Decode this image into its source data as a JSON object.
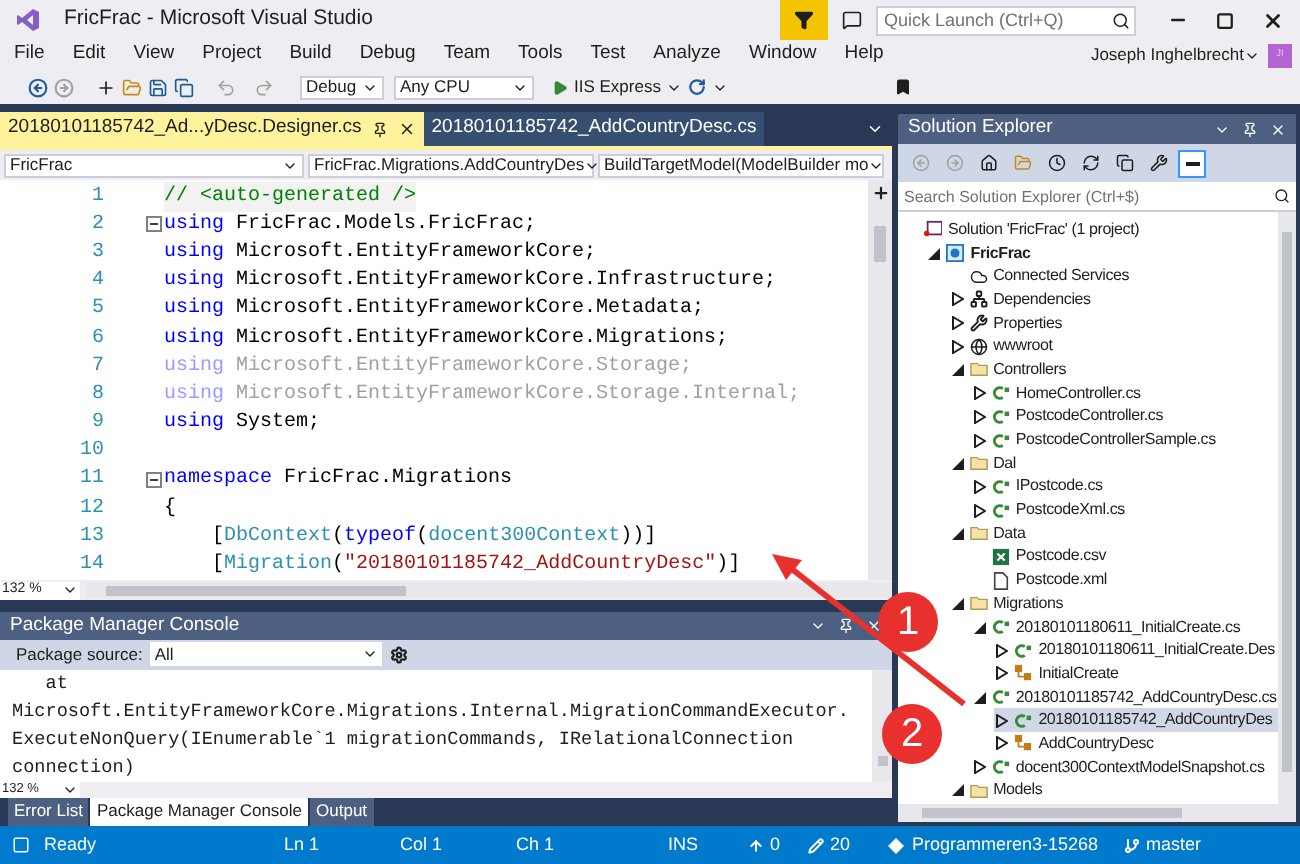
{
  "window": {
    "title": "FricFrac - Microsoft Visual Studio",
    "quick_launch": {
      "placeholder": "Quick Launch (Ctrl+Q)"
    }
  },
  "menu": [
    "File",
    "Edit",
    "View",
    "Project",
    "Build",
    "Debug",
    "Team",
    "Tools",
    "Test",
    "Analyze",
    "Window",
    "Help"
  ],
  "user": {
    "name": "Joseph Inghelbrecht",
    "initials": "JI"
  },
  "toolbar": {
    "configuration": "Debug",
    "platform": "Any CPU",
    "run": "IIS Express"
  },
  "editor": {
    "tabs": [
      {
        "label": "20180101185742_Ad...yDesc.Designer.cs",
        "selected": true
      },
      {
        "label": "20180101185742_AddCountryDesc.cs",
        "selected": false
      }
    ],
    "nav": [
      "FricFrac",
      "FricFrac.Migrations.AddCountryDes",
      "BuildTargetModel(ModelBuilder mo"
    ],
    "lines": [
      {
        "number": "1",
        "fold": false,
        "dim": false,
        "tokens": [
          {
            "kind": "comment",
            "text": "// <auto-generated />"
          }
        ]
      },
      {
        "number": "2",
        "fold": true,
        "dim": false,
        "tokens": [
          {
            "kind": "keyword",
            "text": "using"
          },
          {
            "kind": "plain",
            "text": " FricFrac.Models.FricFrac;"
          }
        ]
      },
      {
        "number": "3",
        "fold": false,
        "dim": false,
        "tokens": [
          {
            "kind": "keyword",
            "text": "using"
          },
          {
            "kind": "plain",
            "text": " Microsoft.EntityFrameworkCore;"
          }
        ]
      },
      {
        "number": "4",
        "fold": false,
        "dim": false,
        "tokens": [
          {
            "kind": "keyword",
            "text": "using"
          },
          {
            "kind": "plain",
            "text": " Microsoft.EntityFrameworkCore.Infrastructure;"
          }
        ]
      },
      {
        "number": "5",
        "fold": false,
        "dim": false,
        "tokens": [
          {
            "kind": "keyword",
            "text": "using"
          },
          {
            "kind": "plain",
            "text": " Microsoft.EntityFrameworkCore.Metadata;"
          }
        ]
      },
      {
        "number": "6",
        "fold": false,
        "dim": false,
        "tokens": [
          {
            "kind": "keyword",
            "text": "using"
          },
          {
            "kind": "plain",
            "text": " Microsoft.EntityFrameworkCore.Migrations;"
          }
        ]
      },
      {
        "number": "7",
        "fold": false,
        "dim": true,
        "tokens": [
          {
            "kind": "keyword",
            "text": "using"
          },
          {
            "kind": "plain",
            "text": " Microsoft.EntityFrameworkCore.Storage;"
          }
        ]
      },
      {
        "number": "8",
        "fold": false,
        "dim": true,
        "tokens": [
          {
            "kind": "keyword",
            "text": "using"
          },
          {
            "kind": "plain",
            "text": " Microsoft.EntityFrameworkCore.Storage.Internal;"
          }
        ]
      },
      {
        "number": "9",
        "fold": false,
        "dim": false,
        "tokens": [
          {
            "kind": "keyword",
            "text": "using"
          },
          {
            "kind": "plain",
            "text": " System;"
          }
        ]
      },
      {
        "number": "10"
      },
      {
        "number": "11",
        "fold": true,
        "dim": false,
        "tokens": [
          {
            "kind": "keyword",
            "text": "namespace"
          },
          {
            "kind": "plain",
            "text": " FricFrac.Migrations"
          }
        ]
      },
      {
        "number": "12",
        "fold": false,
        "dim": false,
        "tokens": [
          {
            "kind": "plain",
            "text": "{"
          }
        ]
      },
      {
        "number": "13",
        "fold": false,
        "dim": false,
        "tokens": [
          {
            "kind": "plain",
            "text": "    ["
          },
          {
            "kind": "type",
            "text": "DbContext"
          },
          {
            "kind": "plain",
            "text": "("
          },
          {
            "kind": "keyword",
            "text": "typeof"
          },
          {
            "kind": "plain",
            "text": "("
          },
          {
            "kind": "type",
            "text": "docent300Context"
          },
          {
            "kind": "plain",
            "text": "))]"
          }
        ]
      },
      {
        "number": "14",
        "fold": false,
        "dim": false,
        "tokens": [
          {
            "kind": "plain",
            "text": "    ["
          },
          {
            "kind": "type",
            "text": "Migration"
          },
          {
            "kind": "plain",
            "text": "("
          },
          {
            "kind": "string",
            "text": "\"20180101185742_AddCountryDesc\""
          },
          {
            "kind": "plain",
            "text": ")]"
          }
        ]
      }
    ],
    "zoom": "132 %"
  },
  "console": {
    "title": "Package Manager Console",
    "source_label": "Package source:",
    "source": "All",
    "lines": [
      "   at",
      "Microsoft.EntityFrameworkCore.Migrations.Internal.MigrationCommandExecutor.",
      "ExecuteNonQuery(IEnumerable`1 migrationCommands, IRelationalConnection",
      "connection)"
    ],
    "zoom": "132 %"
  },
  "bottom_tabs": [
    {
      "label": "Error List",
      "selected": false
    },
    {
      "label": "Package Manager Console",
      "selected": true
    },
    {
      "label": "Output",
      "selected": false
    }
  ],
  "solution_explorer": {
    "title": "Solution Explorer",
    "search": {
      "placeholder": "Search Solution Explorer (Ctrl+$)"
    },
    "tree": [
      {
        "label": "Solution 'FricFrac' (1 project)",
        "kind": "solution",
        "has_expander": false,
        "selected": false,
        "bold": false,
        "children": [
          {
            "label": "FricFrac",
            "kind": "project",
            "has_expander": true,
            "expanded": true,
            "selected": false,
            "bold": true,
            "children": [
              {
                "label": "Connected Services",
                "kind": "cloud",
                "has_expander": false,
                "selected": false,
                "bold": false
              },
              {
                "label": "Dependencies",
                "kind": "dependencies",
                "has_expander": true,
                "expanded": false,
                "selected": false,
                "bold": false
              },
              {
                "label": "Properties",
                "kind": "wrench",
                "has_expander": true,
                "expanded": false,
                "selected": false,
                "bold": false
              },
              {
                "label": "wwwroot",
                "kind": "globe",
                "has_expander": true,
                "expanded": false,
                "selected": false,
                "bold": false
              },
              {
                "label": "Controllers",
                "kind": "folder",
                "has_expander": true,
                "expanded": true,
                "selected": false,
                "bold": false,
                "children": [
                  {
                    "label": "HomeController.cs",
                    "kind": "csharp",
                    "has_expander": true,
                    "expanded": false,
                    "selected": false,
                    "bold": false
                  },
                  {
                    "label": "PostcodeController.cs",
                    "kind": "csharp",
                    "has_expander": true,
                    "expanded": false,
                    "selected": false,
                    "bold": false
                  },
                  {
                    "label": "PostcodeControllerSample.cs",
                    "kind": "csharp",
                    "has_expander": true,
                    "expanded": false,
                    "selected": false,
                    "bold": false
                  }
                ]
              },
              {
                "label": "Dal",
                "kind": "folder",
                "has_expander": true,
                "expanded": true,
                "selected": false,
                "bold": false,
                "children": [
                  {
                    "label": "IPostcode.cs",
                    "kind": "csharp",
                    "has_expander": true,
                    "expanded": false,
                    "selected": false,
                    "bold": false
                  },
                  {
                    "label": "PostcodeXml.cs",
                    "kind": "csharp",
                    "has_expander": true,
                    "expanded": false,
                    "selected": false,
                    "bold": false
                  }
                ]
              },
              {
                "label": "Data",
                "kind": "folder",
                "has_expander": true,
                "expanded": true,
                "selected": false,
                "bold": false,
                "children": [
                  {
                    "label": "Postcode.csv",
                    "kind": "spreadsheet",
                    "has_expander": false,
                    "selected": false,
                    "bold": false
                  },
                  {
                    "label": "Postcode.xml",
                    "kind": "xml",
                    "has_expander": false,
                    "selected": false,
                    "bold": false
                  }
                ]
              },
              {
                "label": "Migrations",
                "kind": "folder",
                "has_expander": true,
                "expanded": true,
                "selected": false,
                "bold": false,
                "children": [
                  {
                    "label": "20180101180611_InitialCreate.cs",
                    "kind": "csharp",
                    "has_expander": true,
                    "expanded": true,
                    "selected": false,
                    "bold": false,
                    "children": [
                      {
                        "label": "20180101180611_InitialCreate.Des",
                        "kind": "csharp",
                        "has_expander": true,
                        "expanded": false,
                        "selected": false,
                        "bold": false
                      },
                      {
                        "label": "InitialCreate",
                        "kind": "class",
                        "has_expander": true,
                        "expanded": false,
                        "selected": false,
                        "bold": false
                      }
                    ]
                  },
                  {
                    "label": "20180101185742_AddCountryDesc.cs",
                    "kind": "csharp",
                    "has_expander": true,
                    "expanded": true,
                    "selected": false,
                    "bold": false,
                    "children": [
                      {
                        "label": "20180101185742_AddCountryDes",
                        "kind": "csharp",
                        "has_expander": true,
                        "expanded": false,
                        "selected": true,
                        "bold": false
                      },
                      {
                        "label": "AddCountryDesc",
                        "kind": "class",
                        "has_expander": true,
                        "expanded": false,
                        "selected": false,
                        "bold": false
                      }
                    ]
                  },
                  {
                    "label": "docent300ContextModelSnapshot.cs",
                    "kind": "csharp",
                    "has_expander": true,
                    "expanded": false,
                    "selected": false,
                    "bold": false
                  }
                ]
              },
              {
                "label": "Models",
                "kind": "folder",
                "has_expander": true,
                "expanded": true,
                "selected": false,
                "bold": false
              }
            ]
          }
        ]
      }
    ]
  },
  "status_bar": {
    "message": "Ready",
    "ln": "Ln 1",
    "col": "Col 1",
    "ch": "Ch 1",
    "mode": "INS",
    "pushes": "0",
    "changes": "20",
    "repo": "Programmeren3-15268",
    "branch": "master"
  },
  "annotations": [
    {
      "label": "1"
    },
    {
      "label": "2"
    }
  ]
}
